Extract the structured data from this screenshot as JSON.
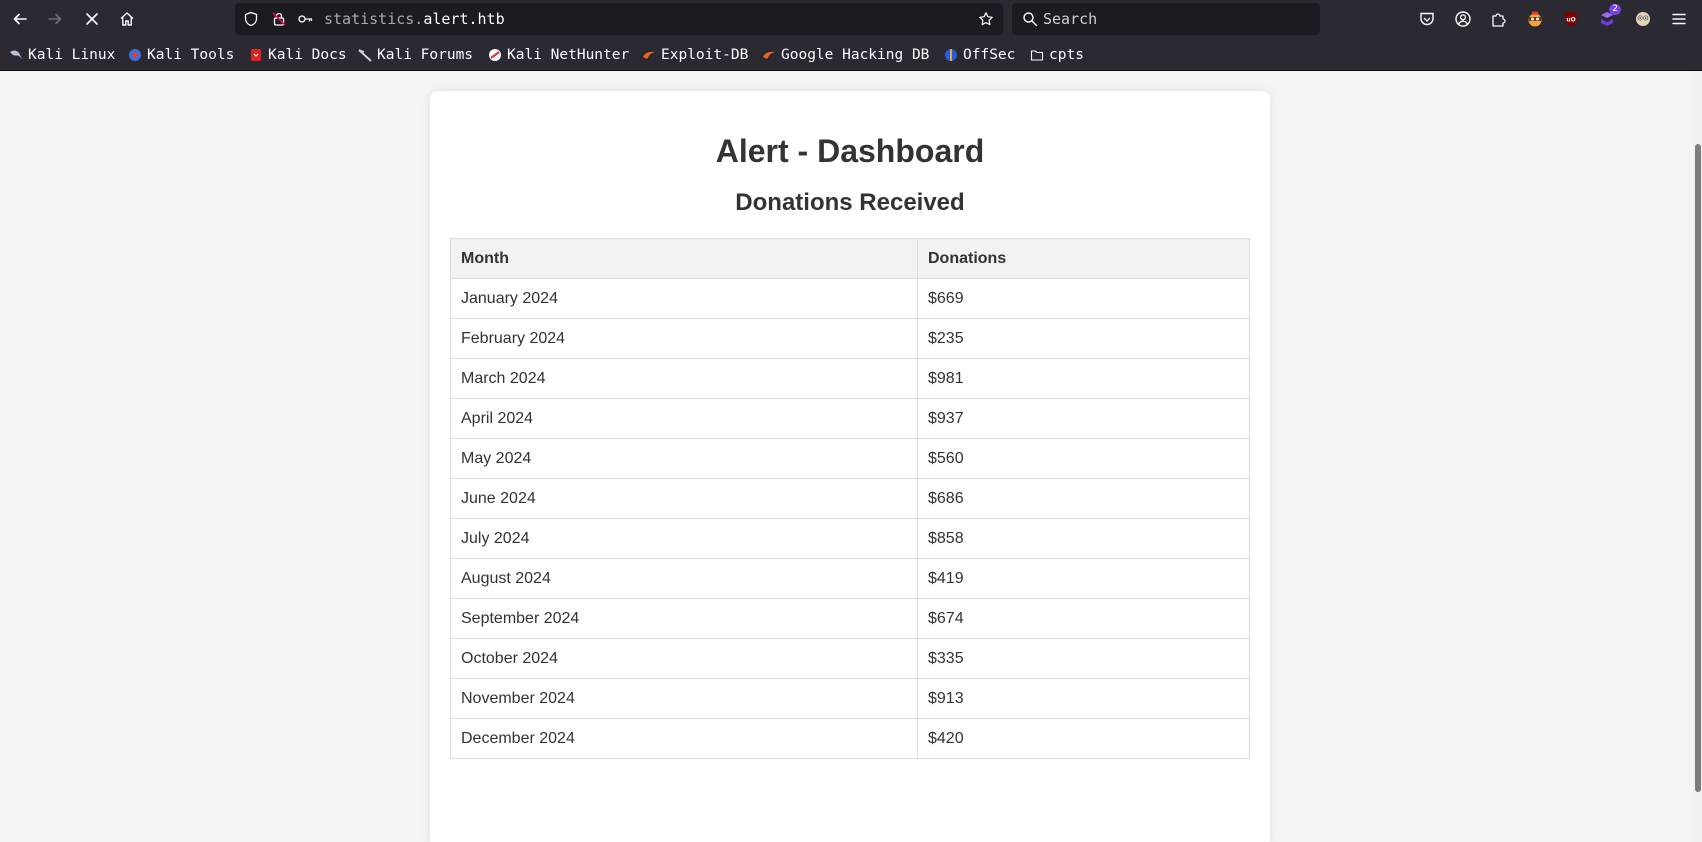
{
  "browser": {
    "url": {
      "subdomain": "statistics.",
      "domain": "alert.htb"
    },
    "search_placeholder": "Search",
    "extension_badge": "2",
    "bookmarks": [
      {
        "label": "Kali Linux",
        "icon": "kali-dragon-icon"
      },
      {
        "label": "Kali Tools",
        "icon": "kali-tools-icon"
      },
      {
        "label": "Kali Docs",
        "icon": "kali-docs-icon"
      },
      {
        "label": "Kali Forums",
        "icon": "kali-forums-icon"
      },
      {
        "label": "Kali NetHunter",
        "icon": "nethunter-icon"
      },
      {
        "label": "Exploit-DB",
        "icon": "exploit-db-icon"
      },
      {
        "label": "Google Hacking DB",
        "icon": "ghdb-icon"
      },
      {
        "label": "OffSec",
        "icon": "offsec-icon"
      },
      {
        "label": "cpts",
        "icon": "folder-icon"
      }
    ]
  },
  "page": {
    "title": "Alert - Dashboard",
    "subtitle": "Donations Received",
    "table": {
      "headers": [
        "Month",
        "Donations"
      ],
      "rows": [
        [
          "January 2024",
          "$669"
        ],
        [
          "February 2024",
          "$235"
        ],
        [
          "March 2024",
          "$981"
        ],
        [
          "April 2024",
          "$937"
        ],
        [
          "May 2024",
          "$560"
        ],
        [
          "June 2024",
          "$686"
        ],
        [
          "July 2024",
          "$858"
        ],
        [
          "August 2024",
          "$419"
        ],
        [
          "September 2024",
          "$674"
        ],
        [
          "October 2024",
          "$335"
        ],
        [
          "November 2024",
          "$913"
        ],
        [
          "December 2024",
          "$420"
        ]
      ]
    }
  },
  "colors": {
    "chrome_bg": "#2b2a33",
    "field_bg": "#1c1b22",
    "page_bg": "#f4f4f4",
    "card_bg": "#ffffff",
    "text": "#333333",
    "header_bg": "#f2f2f2",
    "border": "#dddddd"
  }
}
